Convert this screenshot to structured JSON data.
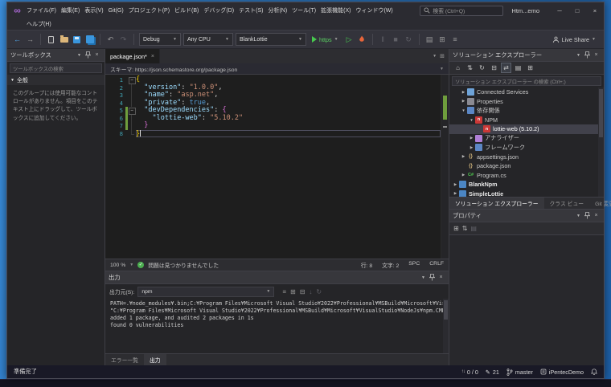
{
  "titlebar": {
    "menus_row1": [
      "ファイル(F)",
      "編集(E)",
      "表示(V)",
      "Git(G)",
      "プロジェクト(P)",
      "ビルド(B)",
      "デバッグ(D)",
      "テスト(S)",
      "分析(N)",
      "ツール(T)",
      "拡張機能(X)",
      "ウィンドウ(W)"
    ],
    "menus_row2": [
      "ヘルプ(H)"
    ],
    "search_placeholder": "検索 (Ctrl+Q)",
    "window_title": "Htm...emo",
    "window_buttons": {
      "minimize": "─",
      "maximize": "□",
      "close": "×"
    }
  },
  "toolbar": {
    "configuration": "Debug",
    "platform": "Any CPU",
    "startup_project": "BlankLottie",
    "run_profile": "https",
    "live_share": "Live Share"
  },
  "toolbox": {
    "title": "ツールボックス",
    "search_placeholder": "ツールボックスの検索",
    "group": "全般",
    "empty_text": "このグループには使用可能なコントロールがありません。項目をこのテキスト上にドラッグして、ツールボックスに追加してください。"
  },
  "editor": {
    "tab": "package.json*",
    "schema": "スキーマ: https://json.schemastore.org/package.json",
    "zoom": "100 %",
    "problems": "問題は見つかりませんでした",
    "caret_line": "行: 8",
    "caret_col": "文字: 2",
    "indent_mode": "SPC",
    "eol": "CRLF",
    "code_lines": [
      {
        "n": "1",
        "fold": "box",
        "segs": [
          [
            "b1",
            "{"
          ]
        ]
      },
      {
        "n": "2",
        "fold": "guide",
        "segs": [
          [
            "p",
            "  "
          ],
          [
            "key",
            "\"version\""
          ],
          [
            "p",
            ": "
          ],
          [
            "str",
            "\"1.0.0\""
          ],
          [
            "p",
            ","
          ]
        ]
      },
      {
        "n": "3",
        "fold": "guide",
        "segs": [
          [
            "p",
            "  "
          ],
          [
            "key",
            "\"name\""
          ],
          [
            "p",
            ": "
          ],
          [
            "str",
            "\"asp.net\""
          ],
          [
            "p",
            ","
          ]
        ]
      },
      {
        "n": "4",
        "fold": "guide",
        "segs": [
          [
            "p",
            "  "
          ],
          [
            "key",
            "\"private\""
          ],
          [
            "p",
            ": "
          ],
          [
            "kw",
            "true"
          ],
          [
            "p",
            ","
          ]
        ]
      },
      {
        "n": "5",
        "fold": "box",
        "change": true,
        "segs": [
          [
            "p",
            "  "
          ],
          [
            "key",
            "\"devDependencies\""
          ],
          [
            "p",
            ": "
          ],
          [
            "b2",
            "{"
          ]
        ]
      },
      {
        "n": "6",
        "fold": "guide",
        "change": true,
        "segs": [
          [
            "p",
            "    "
          ],
          [
            "key",
            "\"lottie-web\""
          ],
          [
            "p",
            ": "
          ],
          [
            "str",
            "\"5.10.2\""
          ]
        ]
      },
      {
        "n": "7",
        "fold": "guide",
        "change": true,
        "segs": [
          [
            "p",
            "  "
          ],
          [
            "b2",
            "}"
          ]
        ]
      },
      {
        "n": "8",
        "fold": "end",
        "current": true,
        "caret": true,
        "segs": [
          [
            "b1",
            "}"
          ]
        ]
      }
    ]
  },
  "output": {
    "title": "出力",
    "source_label": "出力元(S):",
    "source_value": "npm",
    "lines": [
      "PATH=.¥node_modules¥.bin;C:¥Program Files¥Microsoft Visual Studio¥2022¥Professional¥MSBuild¥Microsoft¥Visual S",
      "\"C:¥Program Files¥Microsoft Visual Studio¥2022¥Professional¥MSBuild¥Microsoft¥VisualStudio¥NodeJs¥npm.CMD\" in",
      "added 1 package, and audited 2 packages in 1s",
      "found 0 vulnerabilities"
    ],
    "tabs": [
      "エラー一覧",
      "出力"
    ],
    "active_tab": "出力"
  },
  "solution_explorer": {
    "title": "ソリューション エクスプローラー",
    "search_placeholder": "ソリューション エクスプローラー の検索 (Ctrl+;)",
    "tree": [
      {
        "label": "Connected Services",
        "indent": 1,
        "arrow": "▶",
        "icon": "cloud"
      },
      {
        "label": "Properties",
        "indent": 1,
        "arrow": "▶",
        "icon": "properties"
      },
      {
        "label": "依存関係",
        "indent": 1,
        "arrow": "▼",
        "icon": "dependencies"
      },
      {
        "label": "NPM",
        "indent": 2,
        "arrow": "▼",
        "icon": "npm-folder"
      },
      {
        "label": "lottie-web (5.10.2)",
        "indent": 3,
        "arrow": "",
        "icon": "npm-package",
        "selected": true
      },
      {
        "label": "アナライザー",
        "indent": 2,
        "arrow": "▶",
        "icon": "analyzer"
      },
      {
        "label": "フレームワーク",
        "indent": 2,
        "arrow": "▶",
        "icon": "framework"
      },
      {
        "label": "appsettings.json",
        "indent": 1,
        "arrow": "▶",
        "icon": "json"
      },
      {
        "label": "package.json",
        "indent": 1,
        "arrow": "",
        "icon": "json"
      },
      {
        "label": "Program.cs",
        "indent": 1,
        "arrow": "▶",
        "icon": "cs"
      },
      {
        "label": "BlankNpm",
        "indent": 0,
        "arrow": "▶",
        "icon": "project",
        "bold": true
      },
      {
        "label": "SimpleLottie",
        "indent": 0,
        "arrow": "▶",
        "icon": "project",
        "bold": true
      }
    ],
    "tabs": [
      "ソリューション エクスプローラー",
      "クラス ビュー",
      "Git 変更"
    ],
    "active_tab": "ソリューション エクスプローラー"
  },
  "properties": {
    "title": "プロパティ"
  },
  "statusbar": {
    "ready": "準備完了",
    "sync_counts": "0 / 0",
    "pending_edits": "21",
    "branch": "master",
    "repo": "iPentecDemo"
  }
}
